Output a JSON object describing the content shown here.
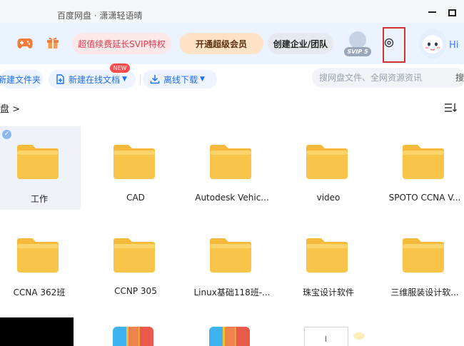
{
  "titlebar": {
    "title": "百度网盘 · 潇潇轻语晴"
  },
  "header": {
    "icons": {
      "game": "gamepad-icon",
      "gift": "gift-icon",
      "settings": "gear-icon"
    },
    "promo_label": "超值续费延长SVIP特权",
    "vip_label": "开通超级会员",
    "org_label": "创建企业/团队",
    "avatar_badge": "SVIP 5",
    "greeting": "Hi"
  },
  "toolbar": {
    "new_folder_label": "新建文件夹",
    "new_doc_label": "新建在线文档",
    "new_badge": "NEW",
    "download_label": "离线下载",
    "search_placeholder": "搜网盘文件、全网资源资讯",
    "search_tail": "搜"
  },
  "breadcrumb": {
    "text": "盘 >"
  },
  "files": [
    {
      "name": "工作",
      "selected": true
    },
    {
      "name": "CAD"
    },
    {
      "name": "Autodesk Vehic..."
    },
    {
      "name": "video"
    },
    {
      "name": "SPOTO CCNA V..."
    },
    {
      "name": "CCNA 362班"
    },
    {
      "name": "CCNP 305"
    },
    {
      "name": "Linux基础118班-..."
    },
    {
      "name": "珠宝设计软件"
    },
    {
      "name": "三维服装设计软..."
    }
  ],
  "colors": {
    "accent": "#1f6ff0",
    "folder": "#f8c54a",
    "highlight": "#d3312c"
  }
}
